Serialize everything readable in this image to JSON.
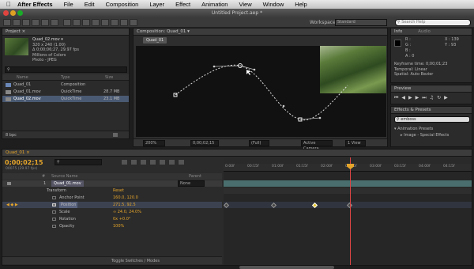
{
  "menubar": {
    "apple": "",
    "app_name": "After Effects",
    "items": [
      "File",
      "Edit",
      "Composition",
      "Layer",
      "Effect",
      "Animation",
      "View",
      "Window",
      "Help"
    ]
  },
  "window": {
    "title": "Untitled Project.aep *"
  },
  "toolbar": {
    "workspace_label": "Workspace:",
    "workspace_value": "Standard",
    "search_placeholder": "Search Help"
  },
  "project_panel": {
    "tab": "Project ×",
    "selected_name": "Quad_02.mov ▾",
    "info": [
      "320 x 240 (1.00)",
      "Δ 0;00;06;27, 29.97 fps",
      "Millions of Colors",
      "Photo - JPEG"
    ],
    "search_placeholder": "",
    "columns": {
      "name": "Name",
      "type": "Type",
      "size": "Size"
    },
    "items": [
      {
        "name": "Quad_01",
        "type": "Composition",
        "size": ""
      },
      {
        "name": "Quad_01.mov",
        "type": "QuickTime",
        "size": "28.7 MB"
      },
      {
        "name": "Quad_02.mov",
        "type": "QuickTime",
        "size": "23.1 MB"
      }
    ],
    "bpc": "8 bpc"
  },
  "comp_panel": {
    "tab": "Composition: Quad_01 ▾",
    "comp_chip": "Quad_01",
    "footer": {
      "zoom": "200%",
      "timecode": "0;00;02;15",
      "resolution": "(Full)",
      "camera": "Active Camera",
      "view": "1 View"
    }
  },
  "info_panel": {
    "tabs": [
      "Info",
      "Audio"
    ],
    "r": "R :",
    "g": "G :",
    "b": "B :",
    "a": "A : 0",
    "x": "X : 139",
    "y": "Y : 93",
    "lines": [
      "Keyframe time: 0;00;01;23",
      "Temporal: Linear",
      "Spatial: Auto Bezier"
    ]
  },
  "preview_panel": {
    "tab": "Preview"
  },
  "effects_panel": {
    "tab": "Effects & Presets",
    "search_value": "emboss",
    "tree": [
      "▾ Animation Presets",
      "▸ Image - Special Effects"
    ]
  },
  "timeline": {
    "tab": "Quad_01 ×",
    "timecode": "0;00;02;15",
    "fps": "00075 (29.97 fps)",
    "columns": {
      "num": "#",
      "source": "Source Name",
      "parent": "Parent"
    },
    "layer": {
      "num": "1",
      "name": "Quad_01.mov",
      "parent": "None"
    },
    "transform": "Transform",
    "reset": "Reset",
    "props": [
      {
        "name": "Anchor Point",
        "value": "160.0, 120.0"
      },
      {
        "name": "Position",
        "value": "271.5, 92.5"
      },
      {
        "name": "Scale",
        "value": "∞ 24.0, 24.0%"
      },
      {
        "name": "Rotation",
        "value": "0x +0.0°"
      },
      {
        "name": "Opacity",
        "value": "100%"
      }
    ],
    "ruler": [
      "0:00f",
      "00:15f",
      "01:00f",
      "01:15f",
      "02:00f",
      "02:15f",
      "03:00f",
      "03:15f",
      "04:00f",
      "04:15f"
    ],
    "footer": "Toggle Switches / Modes",
    "playhead_time": 2.5
  },
  "colors": {
    "accent": "#e5a52b",
    "playhead": "#d44"
  }
}
